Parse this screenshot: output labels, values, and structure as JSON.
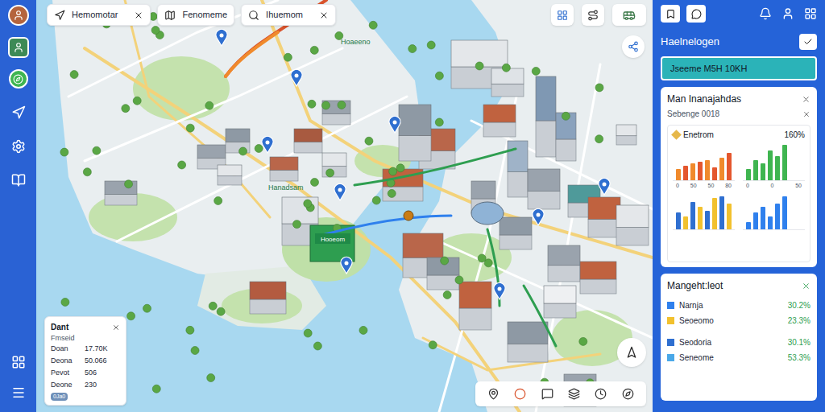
{
  "tabs": [
    {
      "label": "Hemomotar",
      "closable": true
    },
    {
      "label": "Fenomeme",
      "closable": false
    },
    {
      "label": "Ihuemom",
      "closable": true
    }
  ],
  "map": {
    "labels": [
      "Hoaeeno",
      "Hanadsam",
      "Hooeom"
    ]
  },
  "info_card": {
    "title": "Dant",
    "subtitle": "Fmseid",
    "rows": [
      {
        "label": "Doan",
        "value": "17.70K"
      },
      {
        "label": "Deona",
        "value": "50.066"
      },
      {
        "label": "Pevot",
        "value": "506"
      },
      {
        "label": "Deone",
        "value": "230"
      }
    ],
    "tag": "0Ja0"
  },
  "panel": {
    "title": "Haelnelogen",
    "button": "Jseeme M5H 10KH"
  },
  "overview": {
    "title": "Man Inanajahdas",
    "subtitle": "Sebenge 0018",
    "stat": {
      "label": "Enetrom",
      "value": "160%"
    },
    "charts": [
      {
        "series": [
          {
            "color": "#f08a2c",
            "values": [
              30,
              45,
              55,
              60
            ]
          },
          {
            "color": "#e4572e",
            "values": [
              40,
              50,
              35,
              75
            ]
          }
        ],
        "ticks": [
          "0",
          "50",
          "50",
          "80"
        ]
      },
      {
        "series": [
          {
            "color": "#3fb550",
            "values": [
              30,
              55,
              45,
              80,
              65,
              95
            ]
          }
        ],
        "ticks": [
          "0",
          "0",
          "50"
        ]
      },
      {
        "series": [
          {
            "color": "#2f6fd0",
            "values": [
              45,
              75,
              50,
              90
            ]
          },
          {
            "color": "#f2c12e",
            "values": [
              35,
              60,
              85,
              70
            ]
          }
        ],
        "ticks": []
      },
      {
        "series": [
          {
            "color": "#2f80ed",
            "values": [
              20,
              45,
              60,
              35,
              70,
              90
            ]
          }
        ],
        "ticks": []
      }
    ]
  },
  "legend": {
    "title": "Mangeht:leot",
    "items": [
      {
        "label": "Narnja",
        "value": "30.2%",
        "color": "#2f80ed"
      },
      {
        "label": "Seoeomo",
        "value": "23.3%",
        "color": "#f2c12e"
      },
      {
        "label": "Seodoria",
        "value": "30.1%",
        "color": "#2f6fd0"
      },
      {
        "label": "Seneome",
        "value": "53.3%",
        "color": "#4aa8e8"
      }
    ]
  }
}
